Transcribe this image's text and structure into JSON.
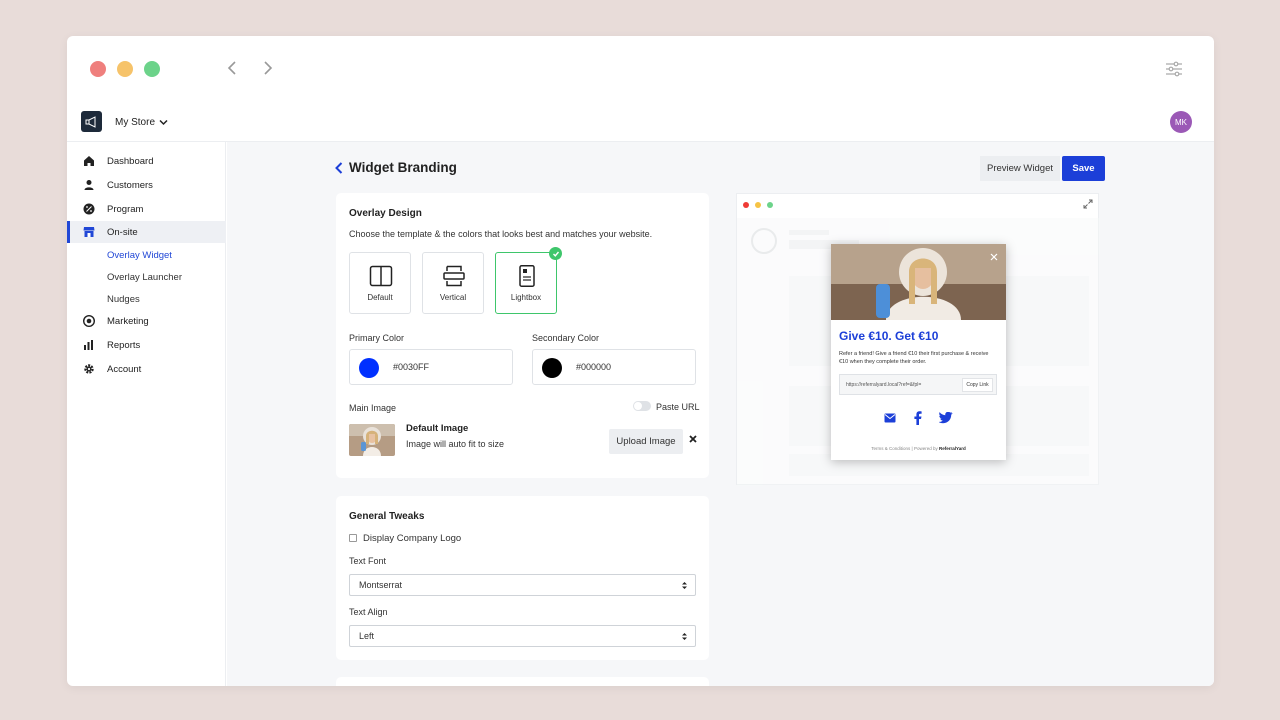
{
  "store": {
    "name": "My Store"
  },
  "user": {
    "initials": "MK"
  },
  "sidebar": {
    "items": [
      {
        "label": "Dashboard",
        "icon": "home-icon"
      },
      {
        "label": "Customers",
        "icon": "user-icon"
      },
      {
        "label": "Program",
        "icon": "percent-icon"
      },
      {
        "label": "On-site",
        "icon": "store-icon"
      },
      {
        "label": "Marketing",
        "icon": "target-icon"
      },
      {
        "label": "Reports",
        "icon": "bar-chart-icon"
      },
      {
        "label": "Account",
        "icon": "gear-icon"
      }
    ],
    "subitems": [
      "Overlay Widget",
      "Overlay Launcher",
      "Nudges"
    ]
  },
  "page": {
    "title": "Widget Branding",
    "preview_label": "Preview Widget",
    "save_label": "Save"
  },
  "overlay": {
    "title": "Overlay Design",
    "desc": "Choose the template & the colors that looks best and matches your website.",
    "templates": [
      "Default",
      "Vertical",
      "Lightbox"
    ],
    "selected_template": "Lightbox",
    "primary_label": "Primary Color",
    "primary_value": "#0030FF",
    "secondary_label": "Secondary Color",
    "secondary_value": "#000000",
    "main_image_label": "Main Image",
    "paste_url_label": "Paste URL",
    "image_title": "Default Image",
    "image_desc": "Image will auto fit to size",
    "upload_label": "Upload Image"
  },
  "tweaks": {
    "title": "General Tweaks",
    "display_logo_label": "Display Company Logo",
    "font_label": "Text Font",
    "font_value": "Montserrat",
    "align_label": "Text Align",
    "align_value": "Left"
  },
  "popup": {
    "headline": "Give €10. Get €10",
    "desc": "Refer a friend! Give a friend €10 their first purchase & receive €10 when they complete their order.",
    "url": "https://referralyard.local?ref=&fpl=",
    "copy_label": "Copy Link",
    "footer_terms": "Terms & Conditions",
    "footer_powered": "Powered by",
    "footer_brand": "ReferralYard"
  },
  "colors": {
    "accent": "#1c3fd8",
    "primary": "#0030FF",
    "secondary": "#000000",
    "success": "#3ec66b"
  }
}
